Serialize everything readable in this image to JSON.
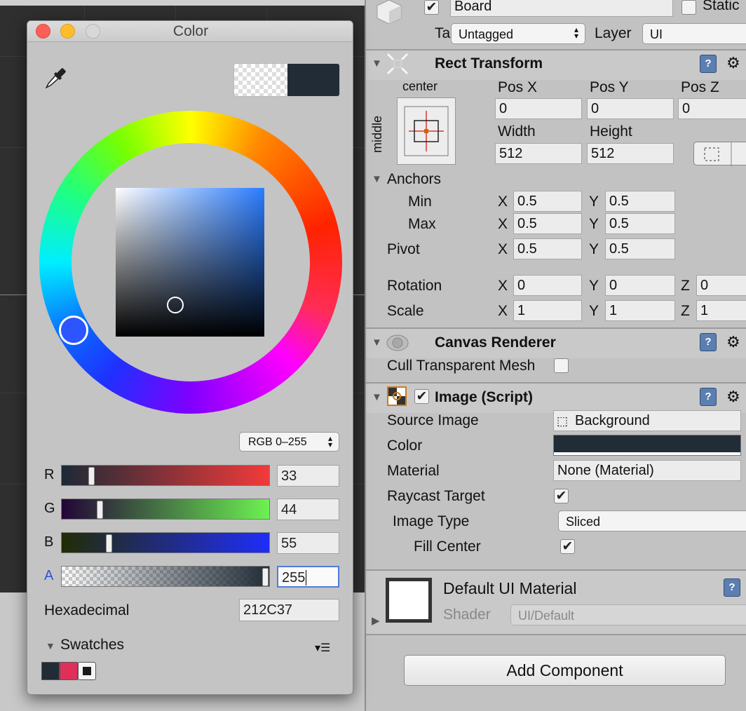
{
  "color_window": {
    "title": "Color",
    "preview_color": "#212C37",
    "mode": "RGB 0–255",
    "channels": [
      {
        "label": "R",
        "value": "33",
        "fraction": 0.129
      },
      {
        "label": "G",
        "value": "44",
        "fraction": 0.173
      },
      {
        "label": "B",
        "value": "55",
        "fraction": 0.216
      },
      {
        "label": "A",
        "value": "255",
        "fraction": 1.0
      }
    ],
    "hex_label": "Hexadecimal",
    "hex_value": "212C37",
    "swatches_label": "Swatches",
    "swatch_colors": [
      "#212C37",
      "#E0305A"
    ]
  },
  "inspector": {
    "object_name": "Board",
    "static_label": "Static",
    "tag_label": "Tag",
    "tag_value": "Untagged",
    "layer_label": "Layer",
    "layer_value": "UI",
    "rect_transform": {
      "title": "Rect Transform",
      "anchor_preset_h": "center",
      "anchor_preset_v": "middle",
      "pos_x_label": "Pos X",
      "pos_x": "0",
      "pos_y_label": "Pos Y",
      "pos_y": "0",
      "pos_z_label": "Pos Z",
      "pos_z": "0",
      "width_label": "Width",
      "width": "512",
      "height_label": "Height",
      "height": "512",
      "anchors_label": "Anchors",
      "min_label": "Min",
      "min_x": "0.5",
      "min_y": "0.5",
      "max_label": "Max",
      "max_x": "0.5",
      "max_y": "0.5",
      "pivot_label": "Pivot",
      "pivot_x": "0.5",
      "pivot_y": "0.5",
      "rotation_label": "Rotation",
      "rot_x": "0",
      "rot_y": "0",
      "rot_z": "0",
      "scale_label": "Scale",
      "scale_x": "1",
      "scale_y": "1",
      "scale_z": "1",
      "axis_x": "X",
      "axis_y": "Y",
      "axis_z": "Z"
    },
    "canvas_renderer": {
      "title": "Canvas Renderer",
      "cull_label": "Cull Transparent Mesh"
    },
    "image": {
      "title": "Image (Script)",
      "source_label": "Source Image",
      "source_value": "Background",
      "color_label": "Color",
      "color_value": "#212C37",
      "material_label": "Material",
      "material_value": "None (Material)",
      "raycast_label": "Raycast Target",
      "image_type_label": "Image Type",
      "image_type_value": "Sliced",
      "fill_center_label": "Fill Center"
    },
    "material": {
      "title": "Default UI Material",
      "shader_label": "Shader",
      "shader_value": "UI/Default"
    },
    "add_component": "Add Component"
  }
}
